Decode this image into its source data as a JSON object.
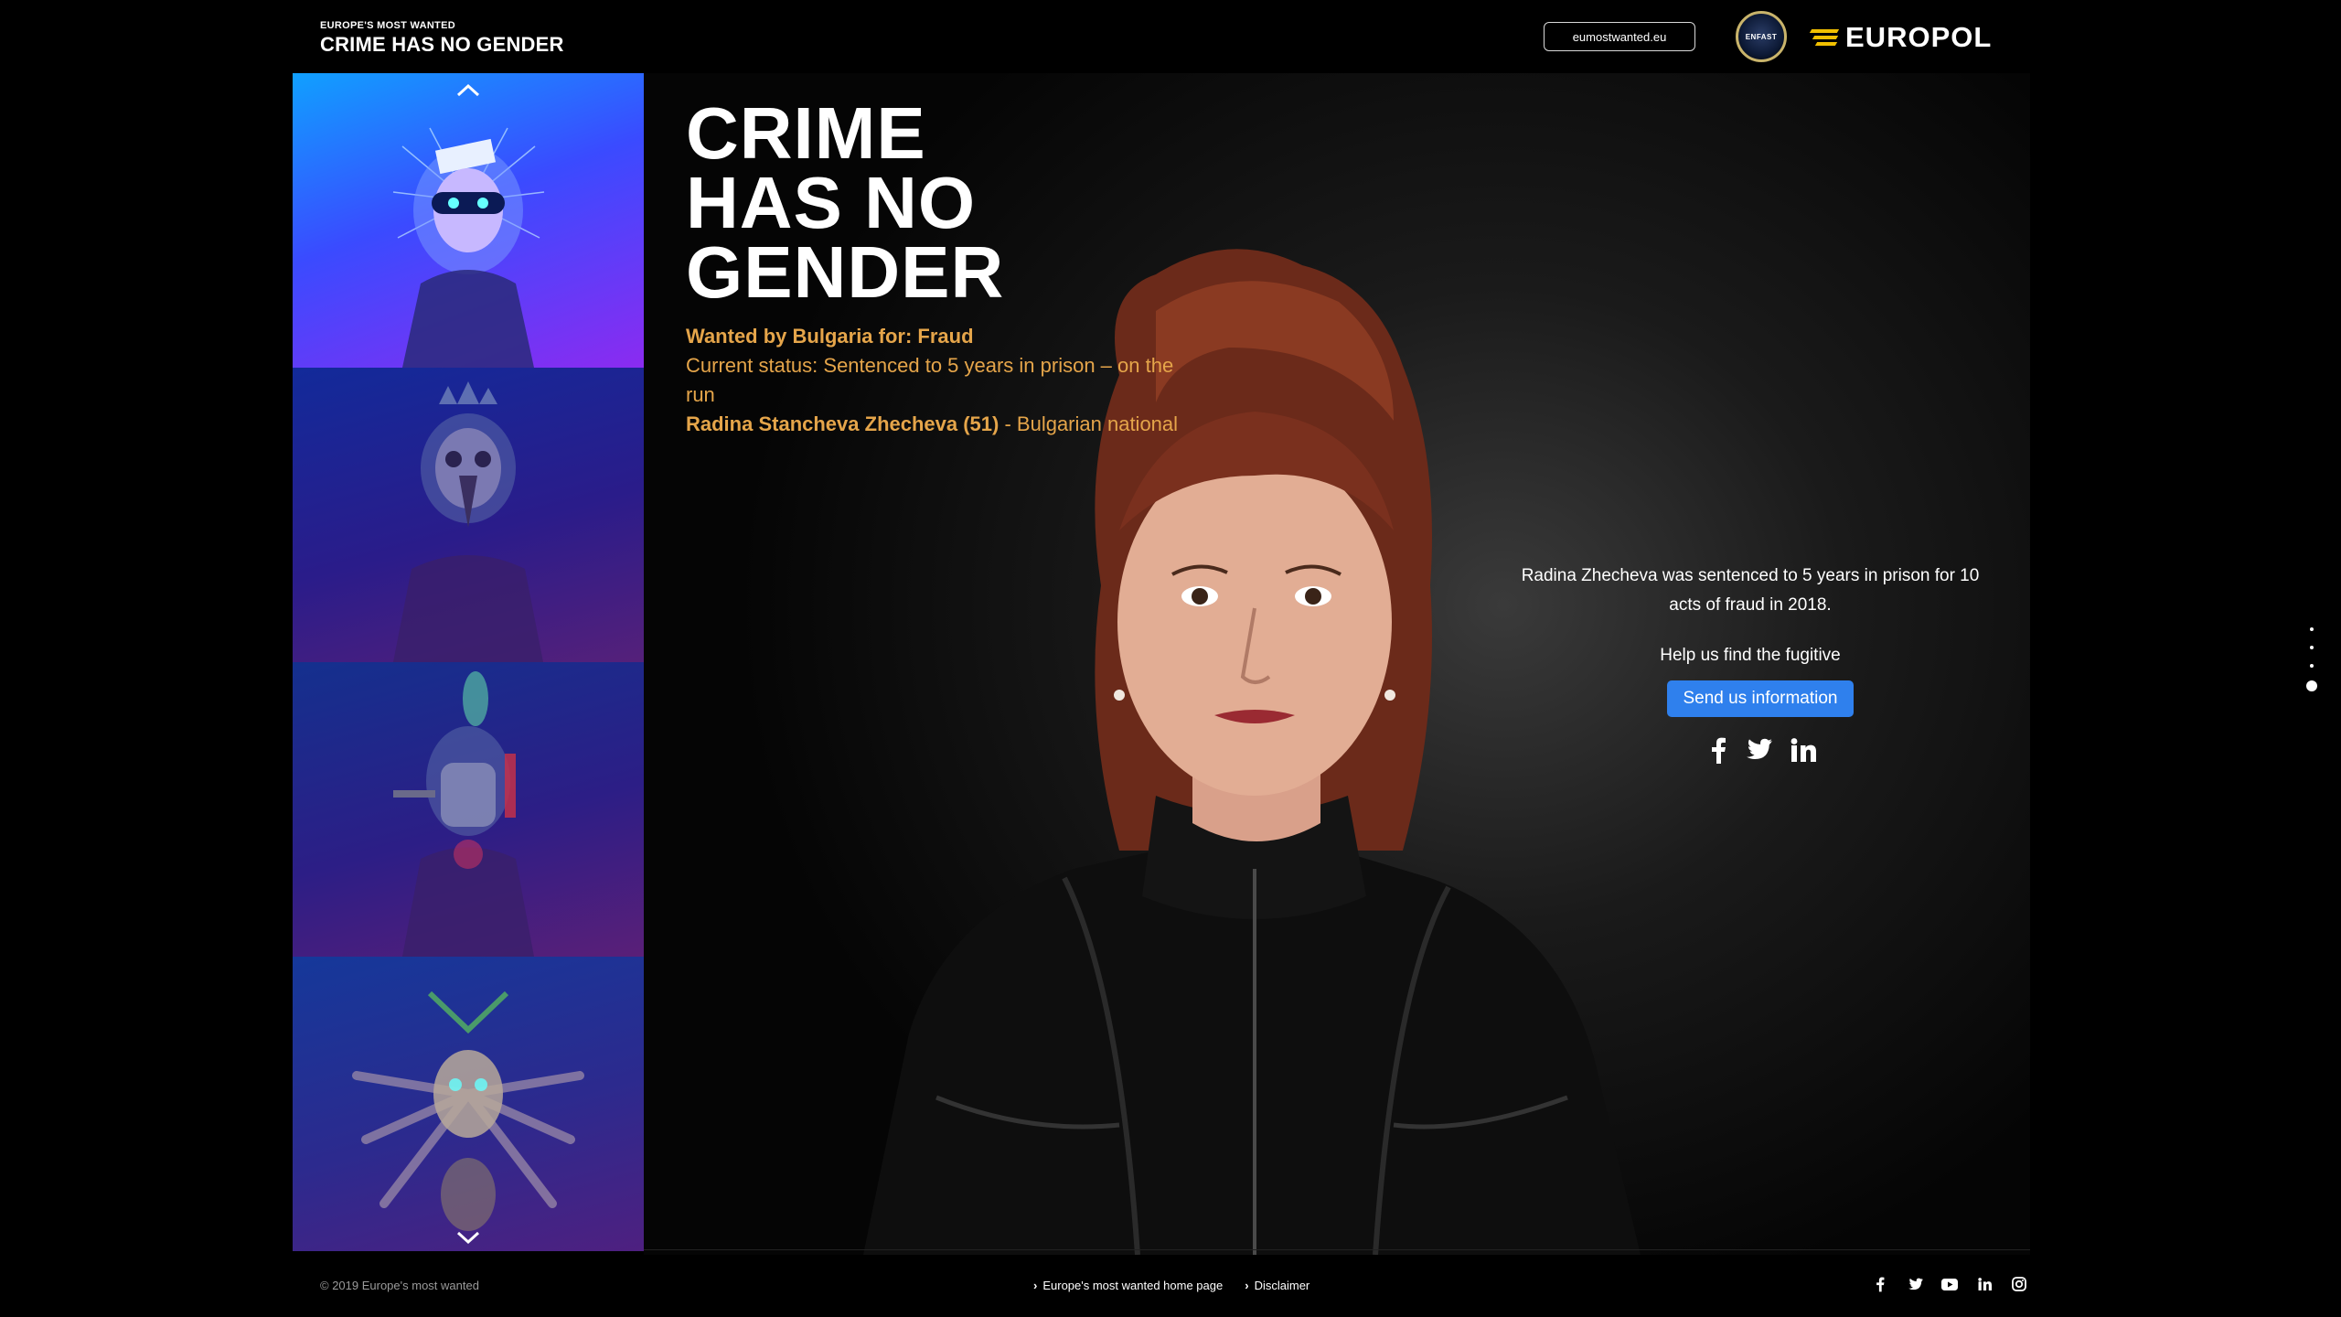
{
  "header": {
    "kicker": "EUROPE'S MOST WANTED",
    "title": "CRIME HAS NO GENDER",
    "site_link": "eumostwanted.eu",
    "enfast_label": "ENFAST",
    "europol_label": "EUROPOL"
  },
  "sidebar": {
    "tiles": [
      {
        "name": "mask-character-one",
        "active": true
      },
      {
        "name": "plague-mask-character",
        "active": false
      },
      {
        "name": "gas-mask-character",
        "active": false
      },
      {
        "name": "spider-character",
        "active": false
      }
    ]
  },
  "main": {
    "headline": [
      "CRIME",
      "HAS NO",
      "GENDER"
    ],
    "wanted_line": "Wanted by Bulgaria for: Fraud",
    "status_line": "Current status: Sentenced to 5 years in prison – on the run",
    "name": "Radina Stancheva Zhecheva (51)",
    "nationality": " - Bulgarian national",
    "description": "Radina Zhecheva was sentenced to 5 years in prison for 10 acts of fraud in 2018.",
    "help_text": "Help us find the fugitive",
    "cta_label": "Send us information"
  },
  "pager": {
    "count": 4,
    "active_index": 3
  },
  "footer": {
    "copyright": "© 2019 Europe's most wanted",
    "links": [
      "Europe's most wanted home page",
      "Disclaimer"
    ]
  },
  "colors": {
    "accent": "#e5a54a",
    "cta": "#2f80ed",
    "brand_yellow": "#f2c000"
  }
}
